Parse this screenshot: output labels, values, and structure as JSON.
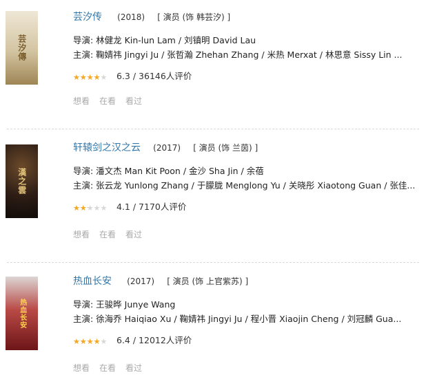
{
  "items": [
    {
      "title": "芸汐传",
      "year": "(2018)",
      "role": "[ 演员 (饰 韩芸汐) ]",
      "director": "导演: 林健龙 Kin-lun Lam / 刘镇明 David Lau",
      "cast": "主演: 鞠婧祎 Jingyi Ju / 张哲瀚 Zhehan Zhang / 米热 Merxat / 林思意 Sissy Lin ...",
      "rating": "6.3 / 36146人评价",
      "stars_fraction": 0.7,
      "actions": [
        "想看",
        "在看",
        "看过"
      ],
      "poster_text": "芸汐傳",
      "poster_colors": {
        "top": "#e9e2d2",
        "bottom": "#b8a77d",
        "text": "#7b6030"
      }
    },
    {
      "title": "轩辕剑之汉之云",
      "year": "(2017)",
      "role": "[ 演员 (饰 兰茵) ]",
      "director": "导演: 潘文杰 Man Kit Poon / 金沙 Sha Jin / 余蓓",
      "cast": "主演: 张云龙 Yunlong Zhang / 于朦胧 Menglong Yu / 关晓彤 Xiaotong Guan / 张佳...",
      "rating": "4.1 / 7170人评价",
      "stars_fraction": 0.4,
      "actions": [
        "想看",
        "在看",
        "看过"
      ],
      "poster_text": "漢之雲",
      "poster_colors": {
        "top": "#3b2820",
        "bottom": "#1b1310",
        "text": "#e0c27a"
      }
    },
    {
      "title": "热血长安",
      "year": "(2017)",
      "role": "[ 演员 (饰 上官紫苏) ]",
      "director": "导演: 王骏晔 Junye Wang",
      "cast": "主演: 徐海乔 Haiqiao Xu / 鞠婧祎 Jingyi Ju / 程小晋 Xiaojin Cheng / 刘冠麟 Gua...",
      "rating": "6.4 / 12012人评价",
      "stars_fraction": 0.7,
      "actions": [
        "想看",
        "在看",
        "看过"
      ],
      "poster_text": "热血长安",
      "poster_colors": {
        "top": "#d8d2cf",
        "bottom": "#8a1f24",
        "text": "#ffd54a"
      }
    }
  ],
  "colors": {
    "accent": "#3377aa",
    "star_active": "#f6a821",
    "star_inactive": "#d7d7d7",
    "action_text": "#aaaaaa",
    "divider": "#d9d9d9"
  }
}
